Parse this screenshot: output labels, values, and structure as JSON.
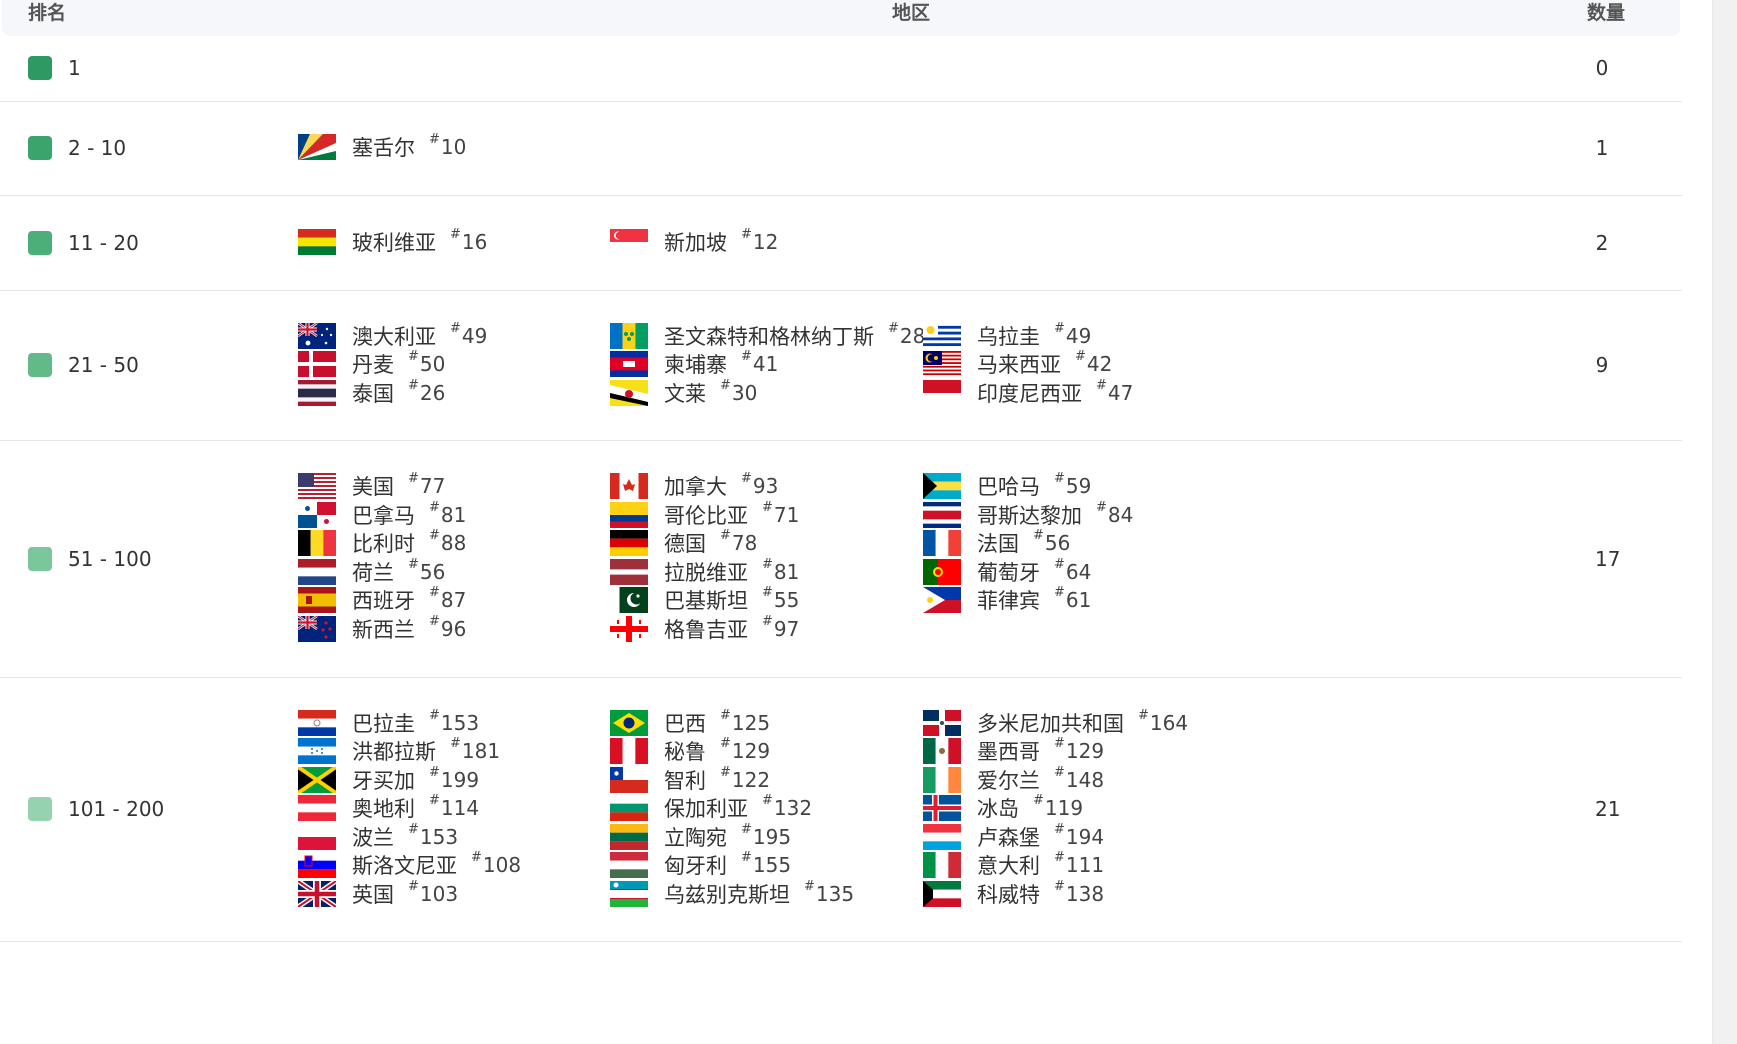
{
  "headers": {
    "rank": "排名",
    "region": "地区",
    "count": "数量"
  },
  "hash_symbol": "#",
  "rows": [
    {
      "rank": "1",
      "count": "0",
      "color": "#2e9a63",
      "cols": []
    },
    {
      "rank": "2 - 10",
      "count": "1",
      "color": "#3aa46c",
      "cols": [
        [
          {
            "name": "塞舌尔",
            "rank": "10",
            "flag": "seychelles"
          }
        ]
      ]
    },
    {
      "rank": "11 - 20",
      "count": "2",
      "color": "#4cae79",
      "cols": [
        [
          {
            "name": "玻利维亚",
            "rank": "16",
            "flag": "bolivia"
          }
        ],
        [
          {
            "name": "新加坡",
            "rank": "12",
            "flag": "singapore"
          }
        ]
      ]
    },
    {
      "rank": "21 - 50",
      "count": "9",
      "color": "#63ba89",
      "cols": [
        [
          {
            "name": "澳大利亚",
            "rank": "49",
            "flag": "australia"
          },
          {
            "name": "丹麦",
            "rank": "50",
            "flag": "denmark"
          },
          {
            "name": "泰国",
            "rank": "26",
            "flag": "thailand"
          }
        ],
        [
          {
            "name": "圣文森特和格林纳丁斯",
            "rank": "28",
            "flag": "stvincent"
          },
          {
            "name": "柬埔寨",
            "rank": "41",
            "flag": "cambodia"
          },
          {
            "name": "文莱",
            "rank": "30",
            "flag": "brunei"
          }
        ],
        [
          {
            "name": "乌拉圭",
            "rank": "49",
            "flag": "uruguay"
          },
          {
            "name": "马来西亚",
            "rank": "42",
            "flag": "malaysia"
          },
          {
            "name": "印度尼西亚",
            "rank": "47",
            "flag": "indonesia"
          }
        ]
      ]
    },
    {
      "rank": "51 - 100",
      "count": "17",
      "color": "#7bc79b",
      "cols": [
        [
          {
            "name": "美国",
            "rank": "77",
            "flag": "usa"
          },
          {
            "name": "巴拿马",
            "rank": "81",
            "flag": "panama"
          },
          {
            "name": "比利时",
            "rank": "88",
            "flag": "belgium"
          },
          {
            "name": "荷兰",
            "rank": "56",
            "flag": "netherlands"
          },
          {
            "name": "西班牙",
            "rank": "87",
            "flag": "spain"
          },
          {
            "name": "新西兰",
            "rank": "96",
            "flag": "newzealand"
          }
        ],
        [
          {
            "name": "加拿大",
            "rank": "93",
            "flag": "canada"
          },
          {
            "name": "哥伦比亚",
            "rank": "71",
            "flag": "colombia"
          },
          {
            "name": "德国",
            "rank": "78",
            "flag": "germany"
          },
          {
            "name": "拉脱维亚",
            "rank": "81",
            "flag": "latvia"
          },
          {
            "name": "巴基斯坦",
            "rank": "55",
            "flag": "pakistan"
          },
          {
            "name": "格鲁吉亚",
            "rank": "97",
            "flag": "georgia"
          }
        ],
        [
          {
            "name": "巴哈马",
            "rank": "59",
            "flag": "bahamas"
          },
          {
            "name": "哥斯达黎加",
            "rank": "84",
            "flag": "costarica"
          },
          {
            "name": "法国",
            "rank": "56",
            "flag": "france"
          },
          {
            "name": "葡萄牙",
            "rank": "64",
            "flag": "portugal"
          },
          {
            "name": "菲律宾",
            "rank": "61",
            "flag": "philippines"
          }
        ]
      ]
    },
    {
      "rank": "101 - 200",
      "count": "21",
      "color": "#95d3ae",
      "cols": [
        [
          {
            "name": "巴拉圭",
            "rank": "153",
            "flag": "paraguay"
          },
          {
            "name": "洪都拉斯",
            "rank": "181",
            "flag": "honduras"
          },
          {
            "name": "牙买加",
            "rank": "199",
            "flag": "jamaica"
          },
          {
            "name": "奥地利",
            "rank": "114",
            "flag": "austria"
          },
          {
            "name": "波兰",
            "rank": "153",
            "flag": "poland"
          },
          {
            "name": "斯洛文尼亚",
            "rank": "108",
            "flag": "slovenia"
          },
          {
            "name": "英国",
            "rank": "103",
            "flag": "uk"
          }
        ],
        [
          {
            "name": "巴西",
            "rank": "125",
            "flag": "brazil"
          },
          {
            "name": "秘鲁",
            "rank": "129",
            "flag": "peru"
          },
          {
            "name": "智利",
            "rank": "122",
            "flag": "chile"
          },
          {
            "name": "保加利亚",
            "rank": "132",
            "flag": "bulgaria"
          },
          {
            "name": "立陶宛",
            "rank": "195",
            "flag": "lithuania"
          },
          {
            "name": "匈牙利",
            "rank": "155",
            "flag": "hungary"
          },
          {
            "name": "乌兹别克斯坦",
            "rank": "135",
            "flag": "uzbekistan"
          }
        ],
        [
          {
            "name": "多米尼加共和国",
            "rank": "164",
            "flag": "dominican"
          },
          {
            "name": "墨西哥",
            "rank": "129",
            "flag": "mexico"
          },
          {
            "name": "爱尔兰",
            "rank": "148",
            "flag": "ireland"
          },
          {
            "name": "冰岛",
            "rank": "119",
            "flag": "iceland"
          },
          {
            "name": "卢森堡",
            "rank": "194",
            "flag": "luxembourg"
          },
          {
            "name": "意大利",
            "rank": "111",
            "flag": "italy"
          },
          {
            "name": "科威特",
            "rank": "138",
            "flag": "kuwait"
          }
        ]
      ]
    }
  ]
}
